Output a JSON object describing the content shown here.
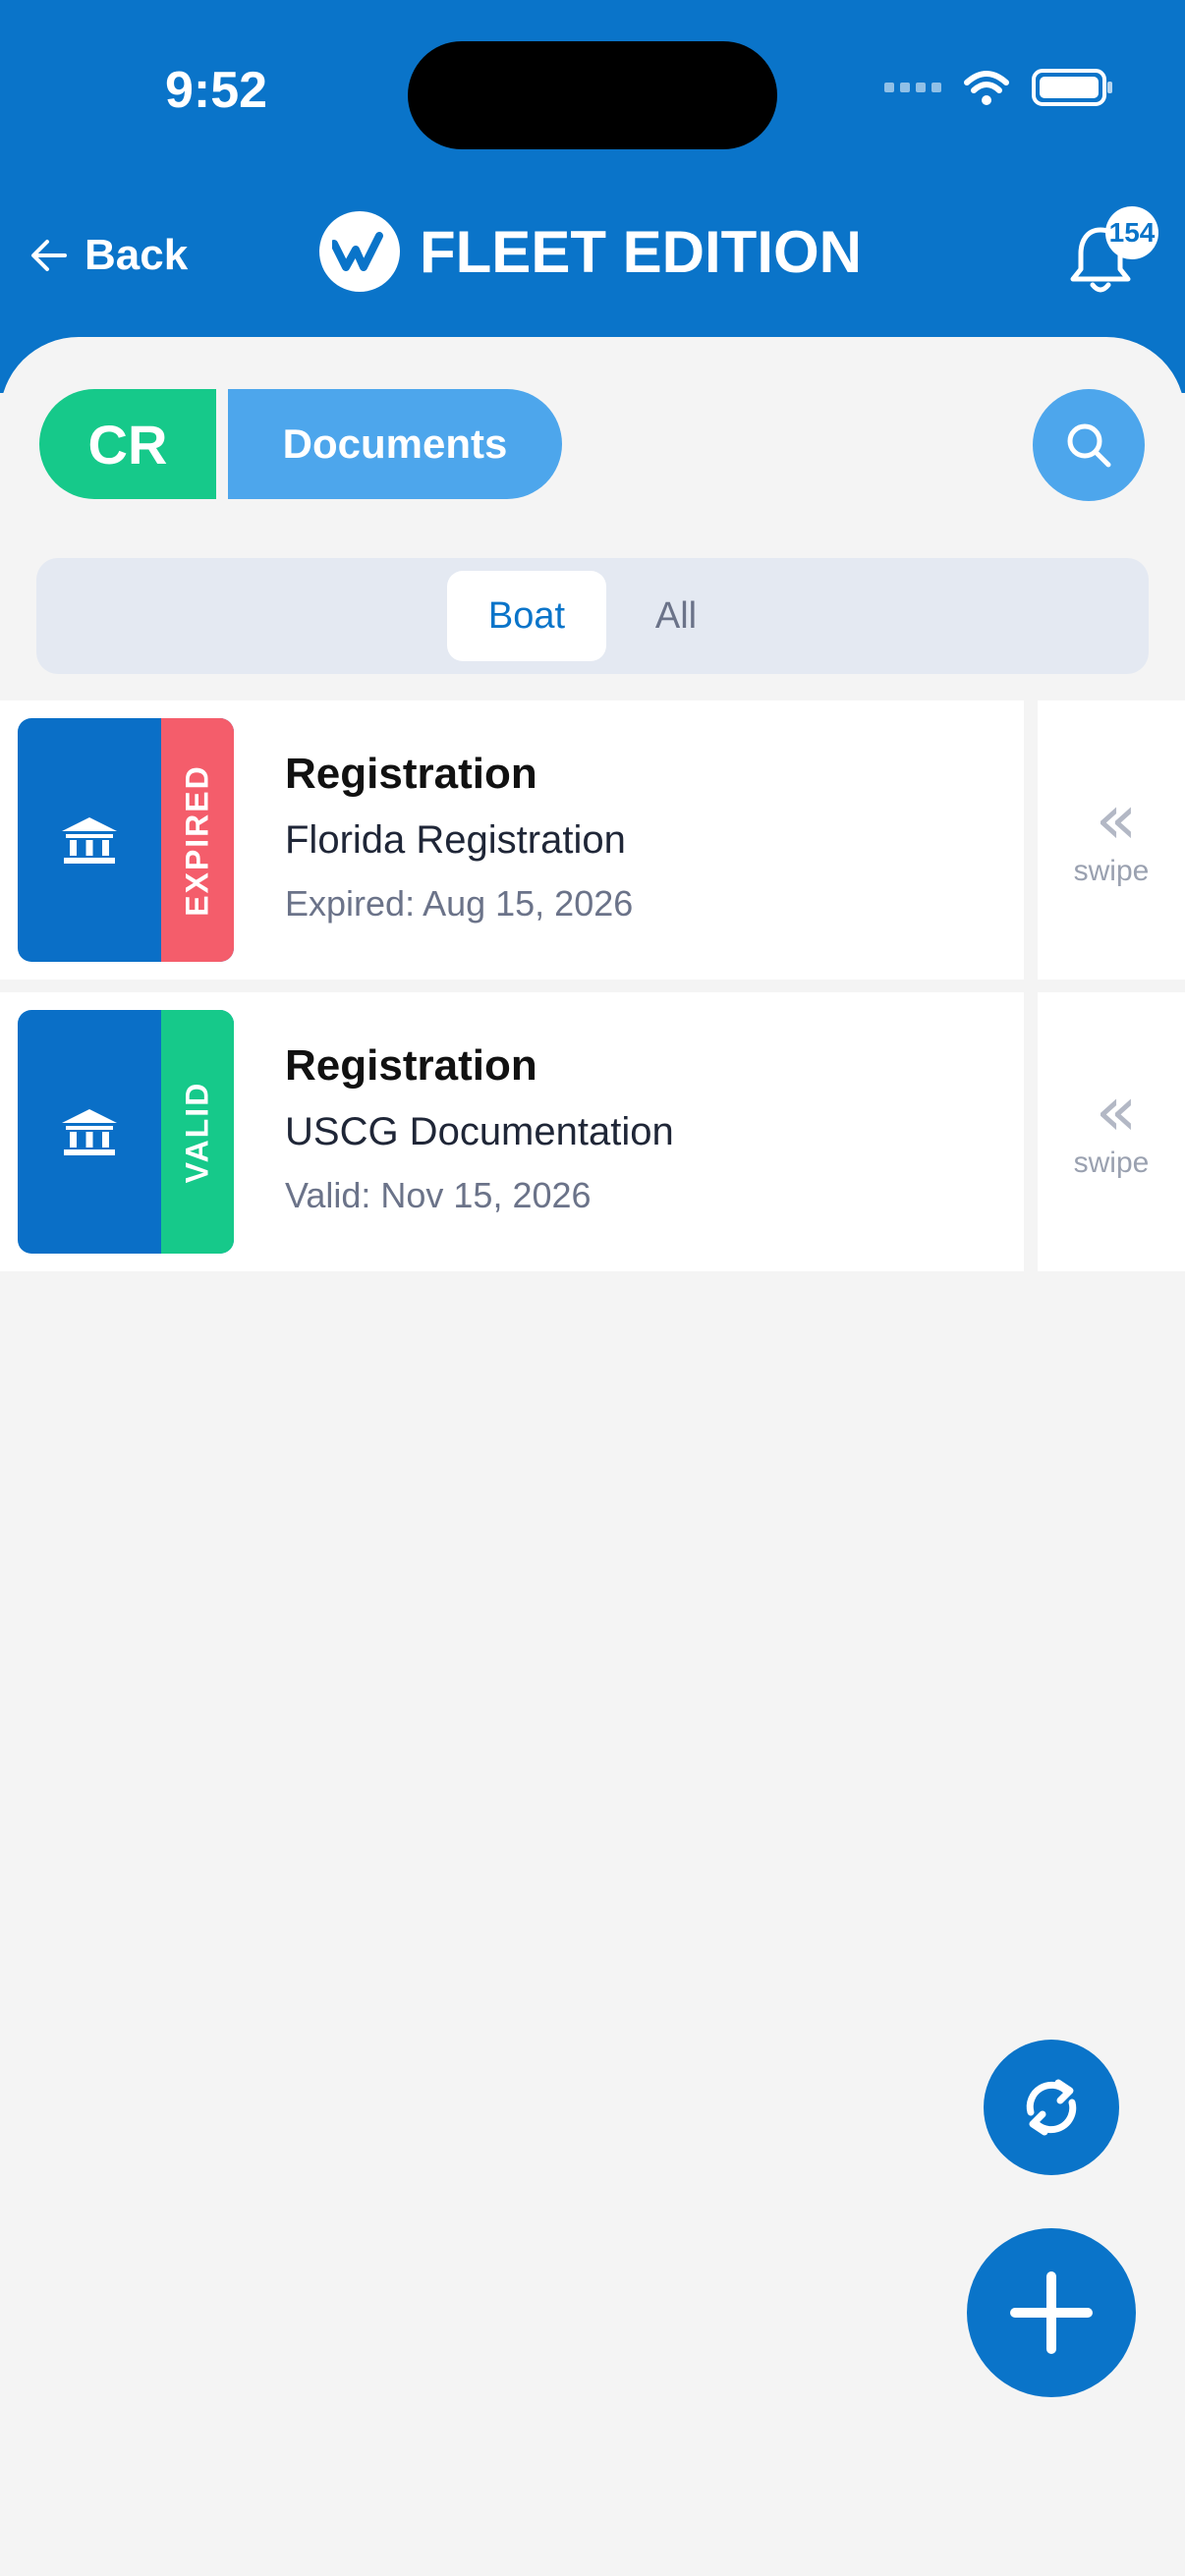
{
  "status_bar": {
    "time": "9:52"
  },
  "header": {
    "back_label": "Back",
    "brand_title": "FLEET EDITION",
    "notification_count": "154"
  },
  "toolbar": {
    "vessel_code": "CR",
    "section_label": "Documents"
  },
  "segmented": {
    "options": [
      "Boat",
      "All"
    ],
    "selected": "Boat"
  },
  "documents": [
    {
      "title": "Registration",
      "subtitle": "Florida Registration",
      "date_text": "Expired: Aug 15, 2026",
      "status": "EXPIRED",
      "status_color": "#f45d6b",
      "swipe_label": "swipe"
    },
    {
      "title": "Registration",
      "subtitle": "USCG Documentation",
      "date_text": "Valid: Nov 15, 2026",
      "status": "VALID",
      "status_color": "#16c98a",
      "swipe_label": "swipe"
    }
  ],
  "colors": {
    "primary": "#0a74c9",
    "accent_green": "#16c98a",
    "light_blue": "#4da6ec",
    "expired_red": "#f45d6b"
  },
  "icons": {
    "back": "arrow-left-icon",
    "notifications": "bell-icon",
    "search": "search-icon",
    "document_type": "bank-building-icon",
    "swipe": "double-chevron-left-icon",
    "refresh": "sync-icon",
    "add": "plus-icon"
  }
}
